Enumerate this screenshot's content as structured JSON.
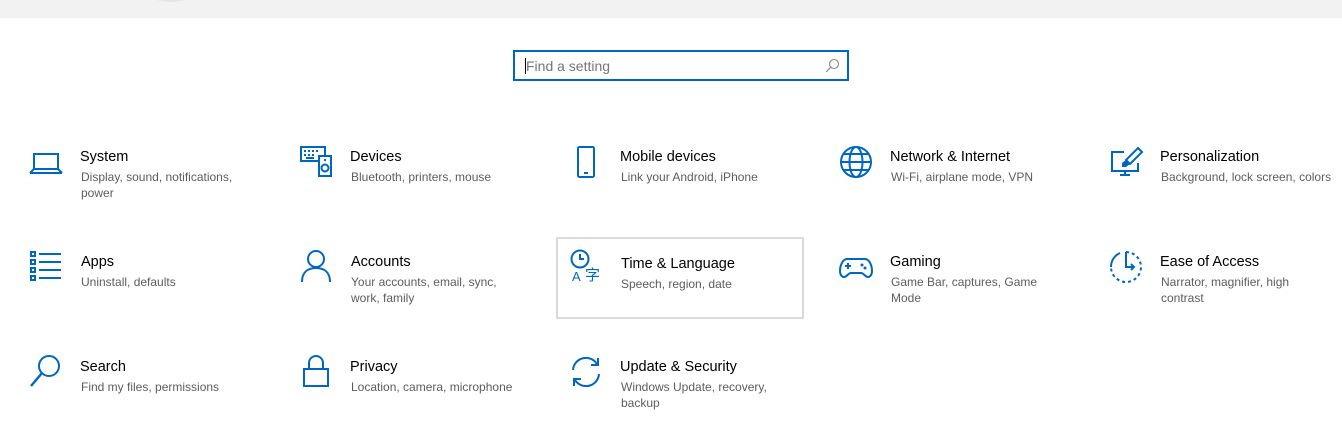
{
  "search": {
    "placeholder": "Find a setting",
    "icon": "search-icon"
  },
  "accent_color": "#0067c0",
  "categories": [
    {
      "id": "system",
      "title": "System",
      "description": "Display, sound, notifications, power",
      "icon": "laptop-icon"
    },
    {
      "id": "devices",
      "title": "Devices",
      "description": "Bluetooth, printers, mouse",
      "icon": "keyboard-speaker-icon"
    },
    {
      "id": "mobile-devices",
      "title": "Mobile devices",
      "description": "Link your Android, iPhone",
      "icon": "phone-icon"
    },
    {
      "id": "network-internet",
      "title": "Network & Internet",
      "description": "Wi-Fi, airplane mode, VPN",
      "icon": "globe-icon"
    },
    {
      "id": "personalization",
      "title": "Personalization",
      "description": "Background, lock screen, colors",
      "icon": "paint-monitor-icon"
    },
    {
      "id": "apps",
      "title": "Apps",
      "description": "Uninstall, defaults",
      "icon": "app-list-icon"
    },
    {
      "id": "accounts",
      "title": "Accounts",
      "description": "Your accounts, email, sync, work, family",
      "icon": "person-icon"
    },
    {
      "id": "time-language",
      "title": "Time & Language",
      "description": "Speech, region, date",
      "icon": "time-language-icon"
    },
    {
      "id": "gaming",
      "title": "Gaming",
      "description": "Game Bar, captures, Game Mode",
      "icon": "gamepad-icon"
    },
    {
      "id": "ease-of-access",
      "title": "Ease of Access",
      "description": "Narrator, magnifier, high contrast",
      "icon": "ease-of-access-icon"
    },
    {
      "id": "search",
      "title": "Search",
      "description": "Find my files, permissions",
      "icon": "magnifier-icon"
    },
    {
      "id": "privacy",
      "title": "Privacy",
      "description": "Location, camera, microphone",
      "icon": "lock-icon"
    },
    {
      "id": "update-security",
      "title": "Update & Security",
      "description": "Windows Update, recovery, backup",
      "icon": "sync-arrows-icon"
    }
  ]
}
